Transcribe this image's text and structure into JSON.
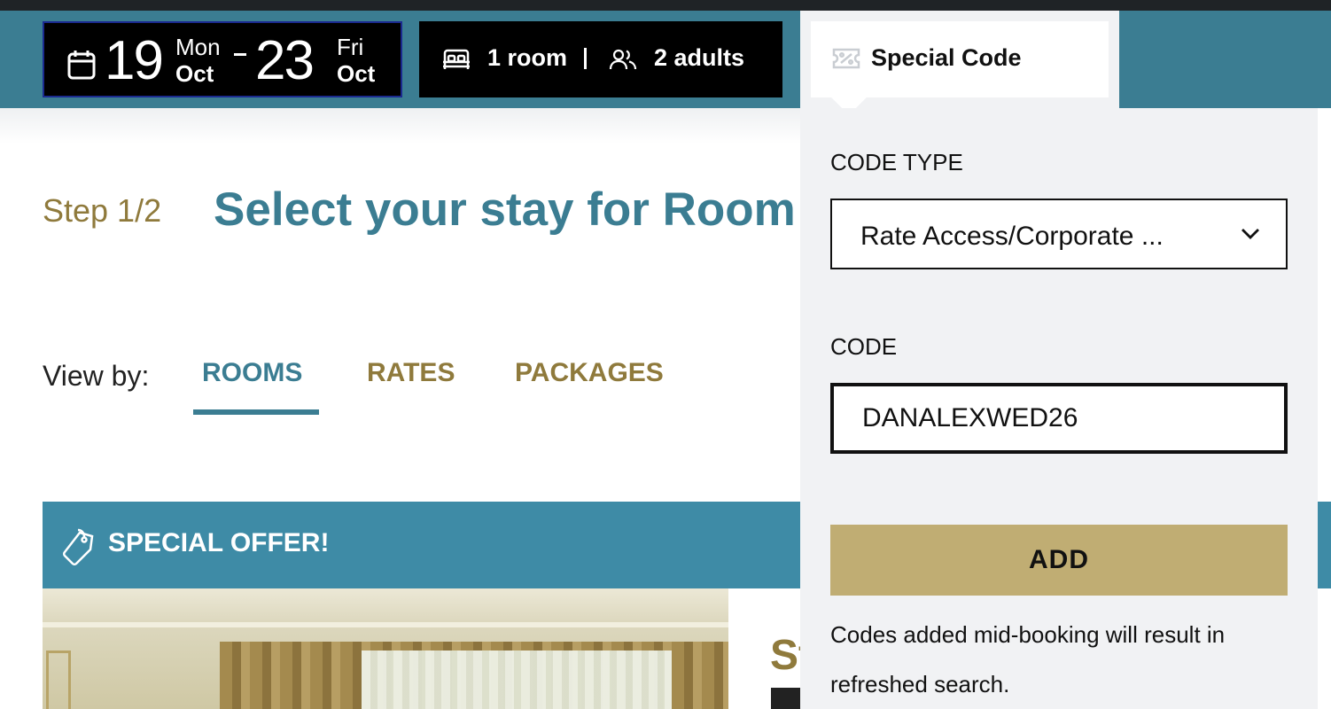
{
  "header": {
    "checkin": {
      "day": "19",
      "weekday": "Mon",
      "month": "Oct"
    },
    "checkout": {
      "day": "23",
      "weekday": "Fri",
      "month": "Oct"
    },
    "rooms": "1 room",
    "separator": "|",
    "adults": "2 adults",
    "special_code_tab": "Special Code"
  },
  "step": {
    "label": "Step 1/2",
    "title": "Select your stay for Room"
  },
  "view_by": {
    "label": "View by:",
    "tabs": [
      "ROOMS",
      "RATES",
      "PACKAGES"
    ],
    "active": "ROOMS"
  },
  "offer": {
    "label": "SPECIAL OFFER!"
  },
  "room_peek": {
    "name_fragment": "St"
  },
  "special_code_panel": {
    "code_type_label": "CODE TYPE",
    "code_type_value": "Rate Access/Corporate ...",
    "code_label": "CODE",
    "code_value": "DANALEXWED26",
    "add_button": "ADD",
    "note": "Codes added mid-booking will result in refreshed search."
  },
  "colors": {
    "header_bg": "#3b7d92",
    "title_teal": "#3b7d92",
    "gold": "#8f7a3c",
    "add_button_bg": "#c0ad73",
    "offer_bg": "#3e8ba6",
    "panel_bg": "#f1f2f4"
  },
  "icons": [
    "calendar-icon",
    "bed-icon",
    "people-icon",
    "ticket-icon",
    "tag-icon",
    "chevron-down-icon"
  ]
}
